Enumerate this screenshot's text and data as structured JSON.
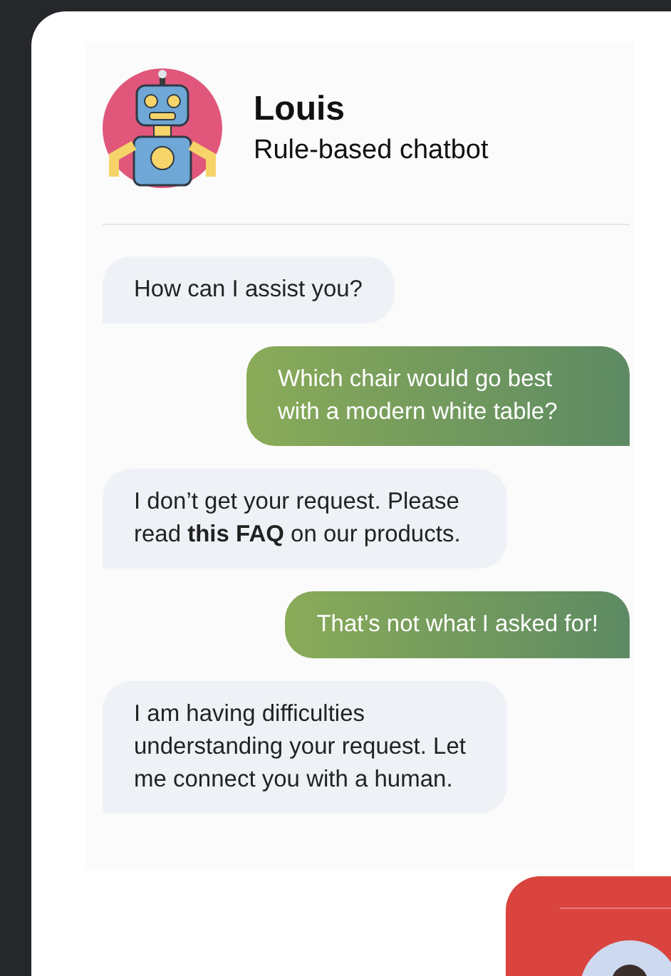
{
  "bot": {
    "name": "Louis",
    "subtitle": "Rule-based chatbot"
  },
  "messages": [
    {
      "kind": "bot",
      "text": "How can I assist you?"
    },
    {
      "kind": "user",
      "text": "Which chair would go best with a modern white table?"
    },
    {
      "kind": "bot",
      "text": "I don’t get your request. Please read **this FAQ** on our products."
    },
    {
      "kind": "user",
      "text": "That’s not what I asked for!"
    },
    {
      "kind": "bot",
      "text": "I am having difficulties understanding your request. Let me connect you with a human."
    }
  ]
}
